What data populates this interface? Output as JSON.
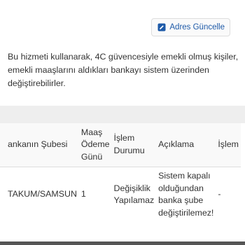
{
  "toolbar": {
    "update_address_label": "Adres Güncelle",
    "update_icon": "edit-icon"
  },
  "description": "Bu hizmeti kullanarak, 4C güvencesiyle emekli olmuş kişiler, emekli maaşlarını aldıkları bankayı sistem üzerinden değiştirebilirler.",
  "table": {
    "headers": {
      "branch": "ankanın Şubesi",
      "payment_day": "Maaş Ödeme Günü",
      "status": "İşlem Durumu",
      "description": "Açıklama",
      "action": "İşlem"
    },
    "rows": [
      {
        "branch": "TAKUM/SAMSUN",
        "payment_day": "1",
        "status": "Değişiklik Yapılamaz",
        "description": "Sistem kapalı olduğundan banka şube değiştirilemez!",
        "action": "-"
      }
    ]
  },
  "colors": {
    "button_text": "#1e5aa8",
    "header_band": "#eeeeee",
    "border": "#dddddd"
  }
}
